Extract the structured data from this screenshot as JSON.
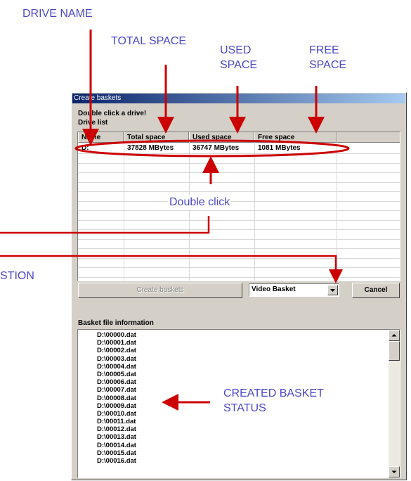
{
  "annotations": {
    "drive_name": "DRIVE NAME",
    "total_space": "TOTAL SPACE",
    "used_space": [
      "USED",
      "SPACE"
    ],
    "free_space": [
      "FREE",
      "SPACE"
    ],
    "double_click": "Double click",
    "selection_partial": "STION",
    "created_basket_status": [
      "CREATED BASKET",
      "STATUS"
    ],
    "color": "#4a48c8",
    "arrow_color": "#cc0000"
  },
  "dialog": {
    "title": "Create baskets",
    "instruction": "Double click a drive!",
    "drive_list_label": "Drive list",
    "columns": [
      "Name",
      "Total space",
      "Used space",
      "Free space"
    ],
    "rows": [
      {
        "name": "D:",
        "total": "37828 MBytes",
        "used": "36747 MBytes",
        "free": "1081 MBytes"
      }
    ],
    "create_button": "Create baskets",
    "basket_type": "Video Basket",
    "cancel_button": "Cancel",
    "file_info_label": "Basket file information",
    "files": [
      "D:\\00000.dat",
      "D:\\00001.dat",
      "D:\\00002.dat",
      "D:\\00003.dat",
      "D:\\00004.dat",
      "D:\\00005.dat",
      "D:\\00006.dat",
      "D:\\00007.dat",
      "D:\\00008.dat",
      "D:\\00009.dat",
      "D:\\00010.dat",
      "D:\\00011.dat",
      "D:\\00012.dat",
      "D:\\00013.dat",
      "D:\\00014.dat",
      "D:\\00015.dat",
      "D:\\00016.dat"
    ]
  }
}
